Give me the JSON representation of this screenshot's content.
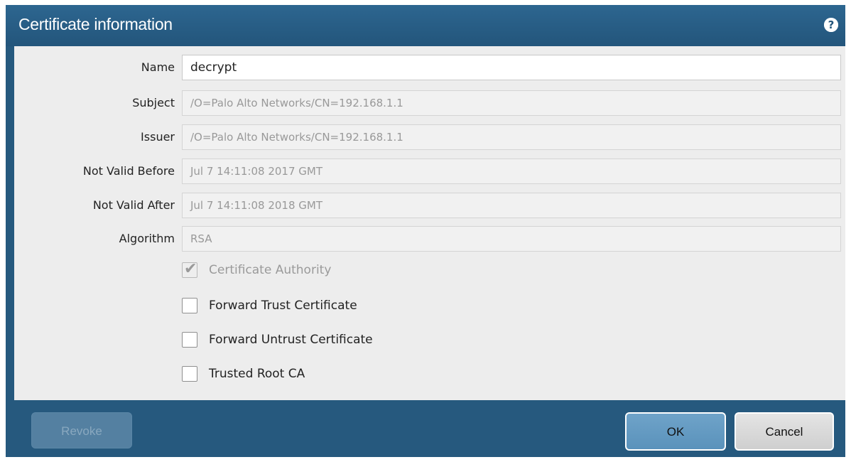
{
  "dialog": {
    "title": "Certificate information",
    "help_icon": "?"
  },
  "fields": [
    {
      "label": "Name",
      "value": "decrypt",
      "editable": true
    },
    {
      "label": "Subject",
      "value": "/O=Palo Alto Networks/CN=192.168.1.1",
      "editable": false
    },
    {
      "label": "Issuer",
      "value": "/O=Palo Alto Networks/CN=192.168.1.1",
      "editable": false
    },
    {
      "label": "Not Valid Before",
      "value": "Jul  7 14:11:08 2017 GMT",
      "editable": false
    },
    {
      "label": "Not Valid After",
      "value": "Jul  7 14:11:08 2018 GMT",
      "editable": false
    },
    {
      "label": "Algorithm",
      "value": "RSA",
      "editable": false
    }
  ],
  "checkboxes": [
    {
      "label": "Certificate Authority",
      "checked": true,
      "disabled": true
    },
    {
      "label": "Forward Trust Certificate",
      "checked": false,
      "disabled": false
    },
    {
      "label": "Forward Untrust Certificate",
      "checked": false,
      "disabled": false
    },
    {
      "label": "Trusted Root CA",
      "checked": false,
      "disabled": false
    }
  ],
  "buttons": {
    "revoke": "Revoke",
    "ok": "OK",
    "cancel": "Cancel"
  },
  "colors": {
    "title_bar": "#2d6690",
    "body_bg": "#ededed",
    "ok_button": "#6fa3c9"
  },
  "icons": {
    "help": "help-icon",
    "check": "checkmark-icon"
  }
}
